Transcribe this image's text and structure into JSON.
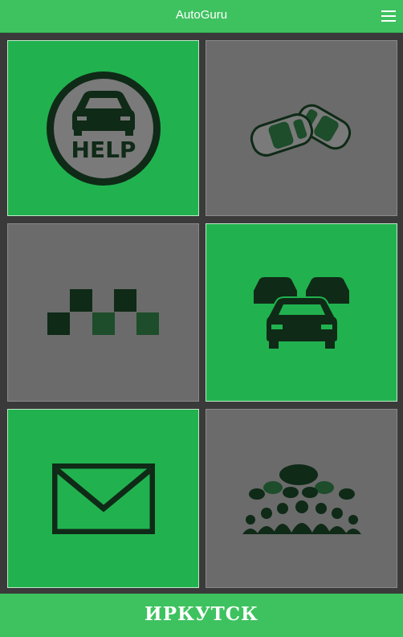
{
  "header": {
    "title": "AutoGuru",
    "menu_icon": "menu-icon"
  },
  "tiles": [
    {
      "id": "help",
      "icon": "help-car-icon",
      "variant": "green"
    },
    {
      "id": "accident",
      "icon": "car-crash-icon",
      "variant": "gray"
    },
    {
      "id": "taxi",
      "icon": "taxi-checker-icon",
      "variant": "gray"
    },
    {
      "id": "traffic",
      "icon": "car-traffic-icon",
      "variant": "green"
    },
    {
      "id": "messages",
      "icon": "envelope-icon",
      "variant": "green"
    },
    {
      "id": "community",
      "icon": "chat-community-icon",
      "variant": "gray"
    }
  ],
  "footer": {
    "city": "ИРКУТСК"
  },
  "colors": {
    "accent": "#3ec25f",
    "tile_green": "#21b24f",
    "tile_gray": "#6b6b6b",
    "icon_dark": "#10301a"
  }
}
